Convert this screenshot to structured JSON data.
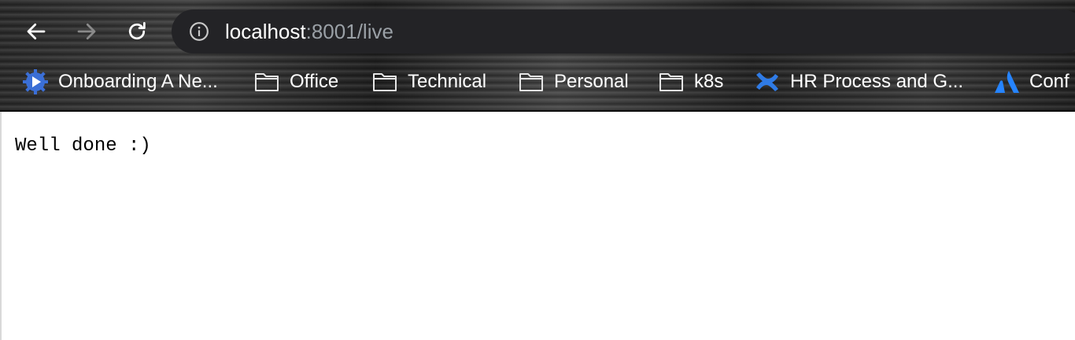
{
  "toolbar": {
    "back_icon": "arrow-left-icon",
    "forward_icon": "arrow-right-icon",
    "reload_icon": "reload-icon",
    "info_icon": "info-icon",
    "url_host": "localhost",
    "url_rest": ":8001/live"
  },
  "bookmarks": [
    {
      "label": "Onboarding A Ne...",
      "icon": "play-gear-icon"
    },
    {
      "label": "Office",
      "icon": "folder-icon"
    },
    {
      "label": "Technical",
      "icon": "folder-icon"
    },
    {
      "label": "Personal",
      "icon": "folder-icon"
    },
    {
      "label": "k8s",
      "icon": "folder-icon"
    },
    {
      "label": "HR Process and G...",
      "icon": "confluence-icon"
    },
    {
      "label": "Conf",
      "icon": "atlassian-icon"
    }
  ],
  "page": {
    "body_text": "Well done :)"
  },
  "colors": {
    "toolbar_bg": "#2a2a2a",
    "omnibox_bg": "#232326",
    "url_host": "#ffffff",
    "url_rest": "#9aa0a6",
    "atlassian_blue": "#2684ff",
    "confluence_blue": "#2f7be6"
  }
}
